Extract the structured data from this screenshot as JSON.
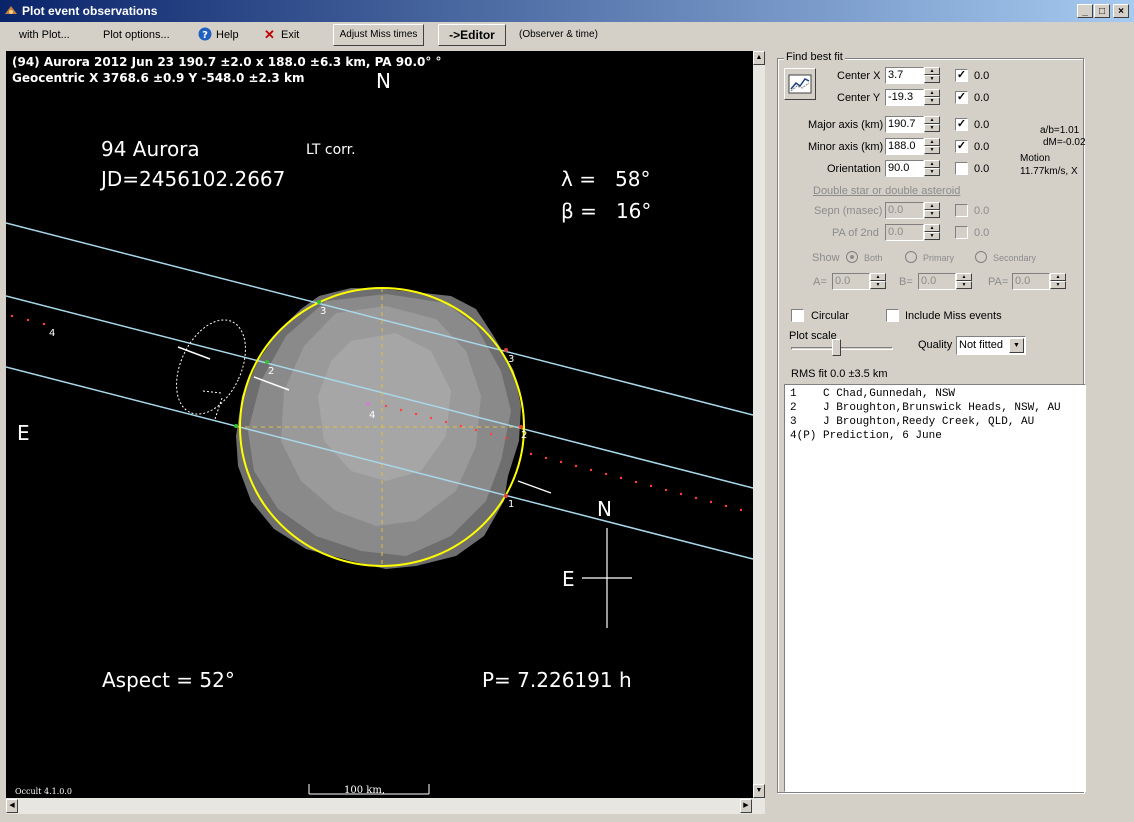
{
  "window": {
    "title": "Plot event observations"
  },
  "menu": {
    "with_plot": "with Plot...",
    "plot_options": "Plot options...",
    "help": "Help",
    "exit": "Exit",
    "adjust_miss": "Adjust Miss times",
    "editor": "->Editor",
    "observer_time": "(Observer & time)"
  },
  "plot": {
    "header_line1": "(94) Aurora  2012 Jun 23  190.7 ±2.0 x 188.0 ±6.3 km, PA 90.0° °",
    "header_line2": "Geocentric X  3768.6 ±0.9  Y -548.0 ±2.3 km",
    "north_top": "N",
    "asteroid_name": "94 Aurora",
    "lt_corr": "LT corr.",
    "jd": "JD=2456102.2667",
    "lambda": "λ =   58°",
    "beta": "β =   16°",
    "east_left": "E",
    "compass_n": "N",
    "compass_e": "E",
    "aspect": "Aspect = 52°",
    "period": "P= 7.226191 h",
    "scale_label": "100 km,",
    "version": "Occult 4.1.0.0",
    "chord_labels": [
      "1",
      "2",
      "3",
      "4"
    ],
    "colors": {
      "fit_ellipse": "#ffff00",
      "chord": "#a8d8ea",
      "model": "#9a9a9a"
    }
  },
  "fit": {
    "group_title": "Find best fit",
    "center_x": {
      "label": "Center X",
      "value": "3.7",
      "checked": true,
      "result": "0.0"
    },
    "center_y": {
      "label": "Center Y",
      "value": "-19.3",
      "checked": true,
      "result": "0.0"
    },
    "major": {
      "label": "Major axis (km)",
      "value": "190.7",
      "checked": true,
      "result": "0.0"
    },
    "minor": {
      "label": "Minor axis (km)",
      "value": "188.0",
      "checked": true,
      "result": "0.0"
    },
    "orientation": {
      "label": "Orientation",
      "value": "90.0",
      "checked": false,
      "result": "0.0"
    },
    "ab": "a/b=1.01",
    "dm": "dM=-0.02",
    "motion_label": "Motion",
    "motion_value": "11.77km/s, X",
    "double_title": "Double star  or  double asteroid",
    "sepn": {
      "label": "Sepn (masec)",
      "value": "0.0",
      "result": "0.0"
    },
    "pa2": {
      "label": "PA of 2nd",
      "value": "0.0",
      "result": "0.0"
    },
    "show_label": "Show",
    "show_options": [
      "Both",
      "Primary",
      "Secondary"
    ],
    "a_label": "A=",
    "a_value": "0.0",
    "b_label": "B=",
    "b_value": "0.0",
    "pa_label": "PA=",
    "pa_value": "0.0",
    "circular": "Circular",
    "include_miss": "Include Miss events",
    "plot_scale": "Plot scale",
    "quality_label": "Quality",
    "quality_value": "Not fitted",
    "rms": "RMS fit 0.0 ±3.5 km"
  },
  "observations": [
    "1    C Chad,Gunnedah, NSW",
    "2    J Broughton,Brunswick Heads, NSW, AU",
    "3    J Broughton,Reedy Creek, QLD, AU",
    "4(P) Prediction, 6 June"
  ]
}
